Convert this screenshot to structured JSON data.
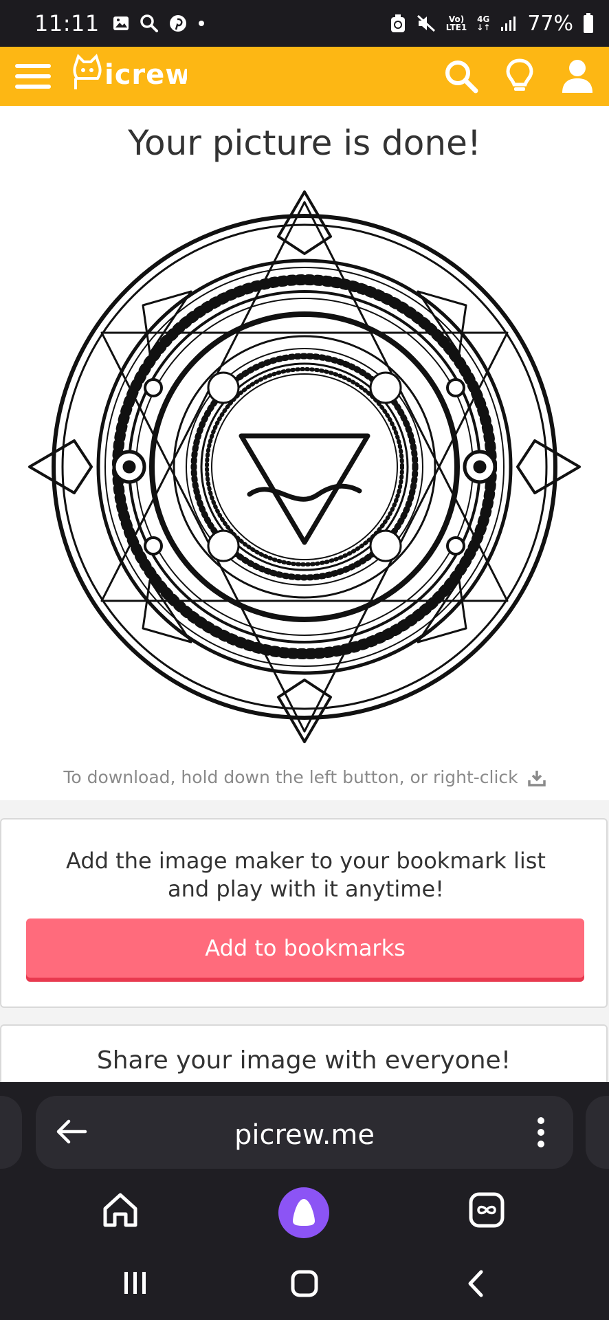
{
  "status_bar": {
    "time": "11:11",
    "network_top": "Vo)",
    "network_bottom": "LTE1",
    "network_type": "4G",
    "battery": "77%"
  },
  "app_bar": {
    "logo_text": "Picrew",
    "icons": [
      "menu-icon",
      "search-icon",
      "lightbulb-icon",
      "user-icon"
    ],
    "color": "#fdb714"
  },
  "main": {
    "title": "Your picture is done!",
    "download_hint": "To download, hold down the left button, or right-click"
  },
  "bookmark_card": {
    "text_line1": "Add the image maker to your bookmark list",
    "text_line2": "and play with it anytime!",
    "button_label": "Add to bookmarks",
    "button_color": "#ff6b7c"
  },
  "share_card": {
    "text": "Share your image with everyone!"
  },
  "browser": {
    "url": "picrew.me",
    "icons": [
      "back-arrow-icon",
      "more-vert-icon",
      "home-icon",
      "assistant-icon",
      "tabs-icon"
    ]
  },
  "system_nav": {
    "icons": [
      "recents-icon",
      "home-nav-icon",
      "back-nav-icon"
    ]
  }
}
